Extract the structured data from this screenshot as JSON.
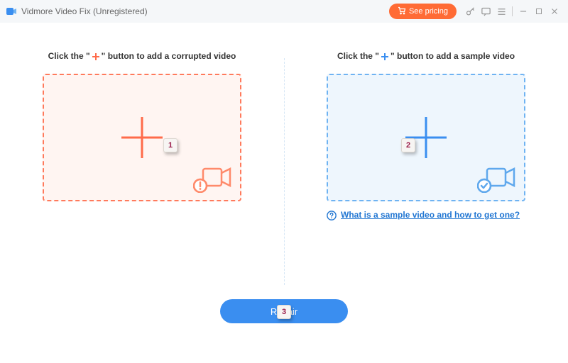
{
  "titlebar": {
    "title": "Vidmore Video Fix (Unregistered)",
    "pricing_label": "See pricing"
  },
  "left": {
    "label_pre": "Click the \"",
    "label_post": "\" button to add a corrupted video"
  },
  "right": {
    "label_pre": "Click the \"",
    "label_post": "\" button to add a sample video",
    "help_text": "What is a sample video and how to get one?"
  },
  "repair_label": "Repair",
  "badges": {
    "b1": "1",
    "b2": "2",
    "b3": "3"
  },
  "colors": {
    "accent_red": "#ff6b4a",
    "accent_blue": "#3a8ef0"
  }
}
